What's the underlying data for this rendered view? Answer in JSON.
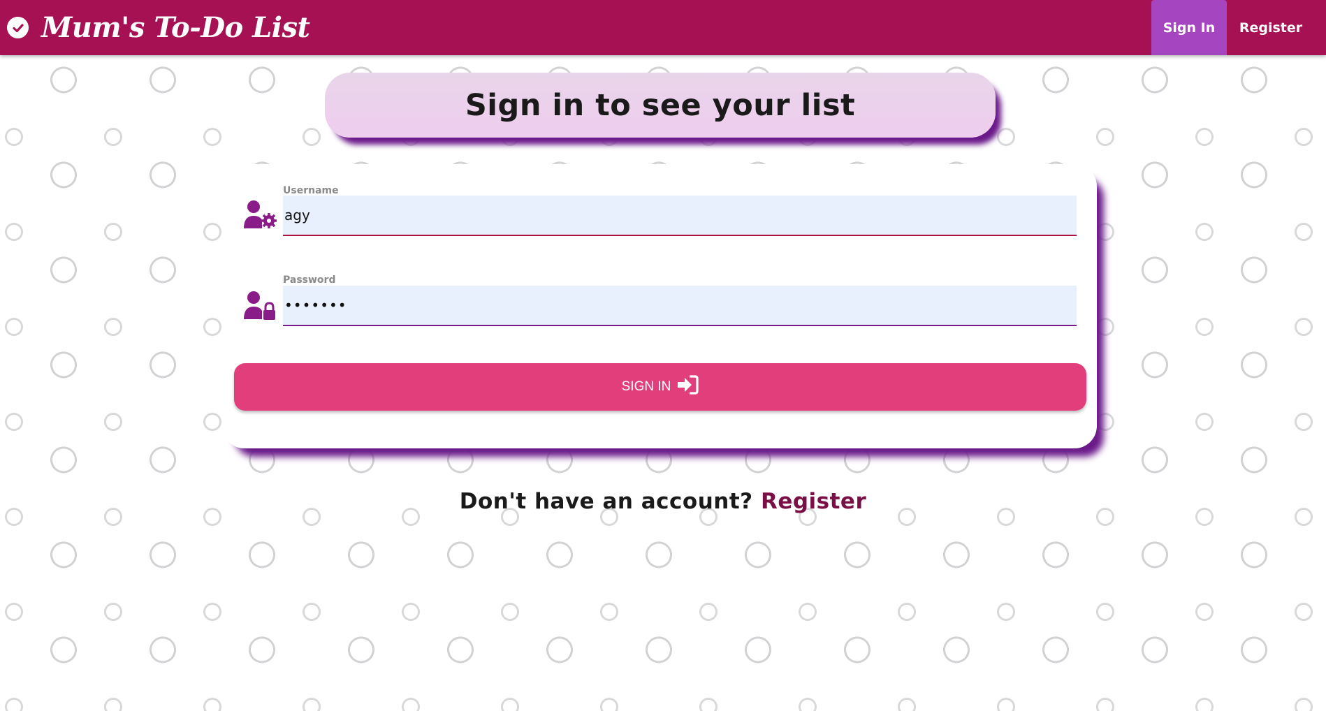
{
  "navbar": {
    "brand_icon": "check-circle-icon",
    "brand_title": "Mum's To-Do List",
    "links": [
      {
        "label": "Sign In",
        "active": true
      },
      {
        "label": "Register",
        "active": false
      }
    ],
    "colors": {
      "bar": "#a51152",
      "active": "#a645c0"
    }
  },
  "page": {
    "heading": "Sign in to see your list"
  },
  "form": {
    "username": {
      "label": "Username",
      "value": "agy",
      "icon": "user-gear-icon"
    },
    "password": {
      "label": "Password",
      "value": "•••••••",
      "icon": "user-lock-icon"
    },
    "submit": {
      "label": "SIGN IN",
      "icon": "sign-in-arrow-icon",
      "color": "#e13e7b"
    }
  },
  "footer": {
    "prompt": "Don't have an account?",
    "link": "Register"
  }
}
